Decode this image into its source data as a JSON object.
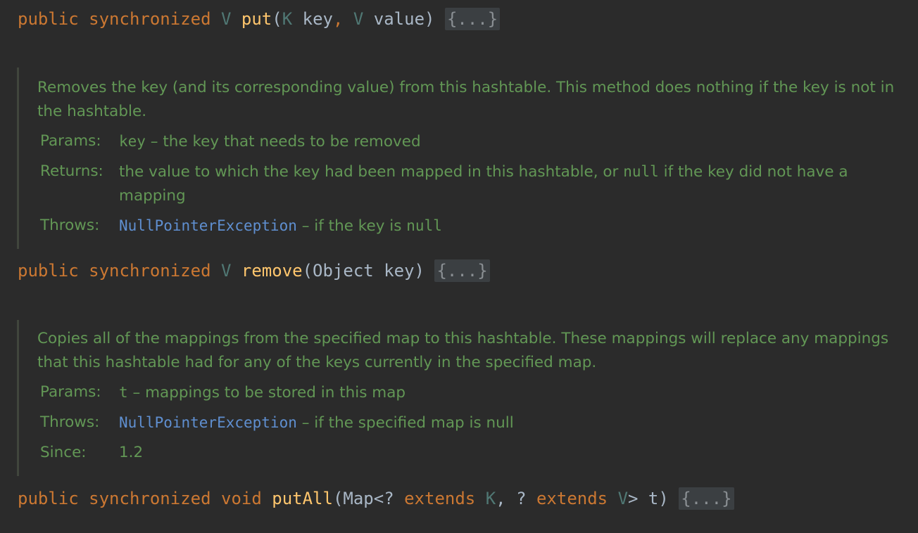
{
  "code": {
    "put": {
      "kw1": "public",
      "kw2": "synchronized",
      "ret": "V",
      "name": "put",
      "open": "(",
      "t1": "K",
      "p1": " key",
      "comma": ",",
      "t2": "V",
      "p2": " value",
      "close": ")",
      "fold": "{...}"
    },
    "remove": {
      "kw1": "public",
      "kw2": "synchronized",
      "ret": "V",
      "name": "remove",
      "params": "(Object key)",
      "fold": "{...}"
    },
    "putall": {
      "kw1": "public",
      "kw2": "synchronized",
      "ret": "void",
      "name": "putAll",
      "p_a": "(Map<? ",
      "ext1": "extends",
      "t1": "K",
      "p_b": ", ? ",
      "ext2": "extends",
      "t2": "V",
      "p_c": "> t)",
      "fold": "{...}"
    }
  },
  "doc_remove": {
    "description": "Removes the key (and its corresponding value) from this hashtable. This method does nothing if the key is not in the hashtable.",
    "params_label": "Params:",
    "param_name": "key",
    "param_desc": " – the key that needs to be removed",
    "returns_label": "Returns:",
    "returns_a": "the value to which the key had been mapped in this hashtable, or ",
    "returns_null": "null",
    "returns_b": " if the key did not have a mapping",
    "throws_label": "Throws:",
    "throws_exception": "NullPointerException",
    "throws_a": " – if the key is ",
    "throws_null": "null"
  },
  "doc_putall": {
    "description": "Copies all of the mappings from the specified map to this hashtable. These mappings will replace any mappings that this hashtable had for any of the keys currently in the specified map.",
    "params_label": "Params:",
    "param_name": "t",
    "param_desc": " – mappings to be stored in this map",
    "throws_label": "Throws:",
    "throws_exception": "NullPointerException",
    "throws_desc": " – if the specified map is null",
    "since_label": "Since:",
    "since_value": "1.2"
  }
}
